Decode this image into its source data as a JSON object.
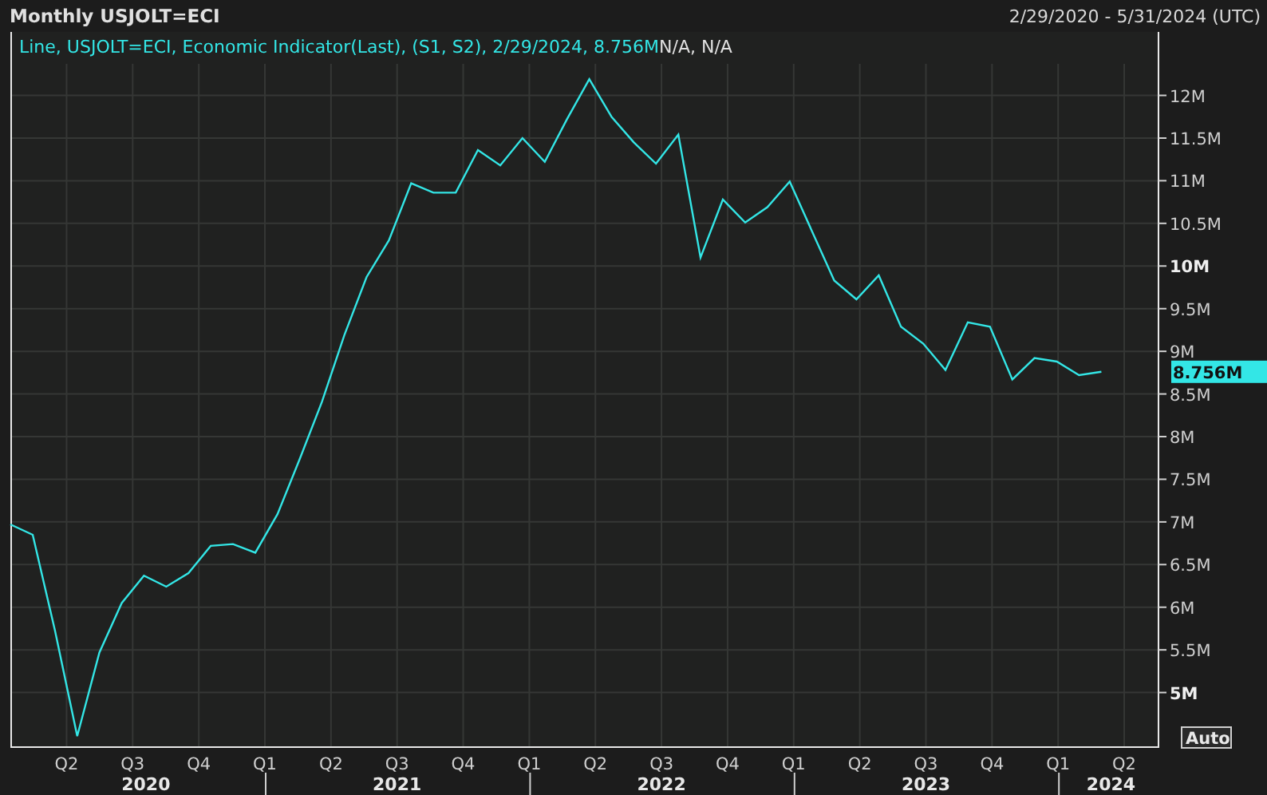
{
  "header": {
    "title": "Monthly USJOLT=ECI",
    "date_range": "2/29/2020 - 5/31/2024 (UTC)"
  },
  "chart": {
    "legend": {
      "series_text": "Line, USJOLT=ECI, Economic Indicator(Last), (S1, S2), 2/29/2024, 8.756M",
      "extra_text": "N/A, N/A"
    },
    "last_value": "8.756M",
    "auto_button": "Auto",
    "quarter_labels": [
      "Q2",
      "Q3",
      "Q4",
      "Q1",
      "Q2",
      "Q3",
      "Q4",
      "Q1",
      "Q2",
      "Q3",
      "Q4",
      "Q1",
      "Q2",
      "Q3",
      "Q4",
      "Q1",
      "Q2"
    ],
    "year_labels": [
      "2020",
      "2021",
      "2022",
      "2023",
      "2024"
    ],
    "chart_data": {
      "type": "line",
      "grid": true,
      "categories": [
        null,
        null,
        null,
        null,
        null,
        null,
        null,
        null,
        null,
        null,
        null,
        null,
        null,
        null,
        null,
        null,
        null,
        null,
        null,
        null,
        null,
        null,
        null,
        null,
        null,
        null,
        null,
        null,
        null,
        null,
        null,
        null,
        null,
        null,
        null,
        null,
        null,
        null,
        null,
        null,
        null,
        null,
        null,
        null,
        null,
        null,
        null,
        null,
        null,
        null
      ],
      "series": [
        {
          "color": "#33e6e6",
          "values": [
            6.97,
            6.85,
            5.73,
            4.49,
            5.47,
            6.05,
            6.37,
            6.24,
            6.4,
            6.72,
            6.74,
            6.64,
            7.09,
            7.74,
            8.41,
            9.19,
            9.87,
            10.3,
            10.97,
            10.86,
            10.86,
            11.36,
            11.18,
            11.5,
            11.22,
            11.72,
            12.19,
            11.75,
            11.45,
            11.2,
            11.54,
            10.1,
            10.78,
            10.51,
            10.69,
            10.99,
            10.41,
            9.83,
            9.61,
            9.89,
            9.29,
            9.09,
            8.78,
            9.34,
            9.29,
            8.67,
            8.92,
            8.88,
            8.72,
            8.76
          ]
        }
      ],
      "ylim": [
        4.36,
        12.37
      ],
      "yticks": [
        {
          "value": 12,
          "label": "12M"
        },
        {
          "value": 11.5,
          "label": "11.5M"
        },
        {
          "value": 11,
          "label": "11M"
        },
        {
          "value": 10.5,
          "label": "10.5M"
        },
        {
          "value": 10,
          "label": "10M"
        },
        {
          "value": 9.5,
          "label": "9.5M"
        },
        {
          "value": 9,
          "label": "9M"
        },
        {
          "value": 8.5,
          "label": "8.5M"
        },
        {
          "value": 8,
          "label": "8M"
        },
        {
          "value": 7.5,
          "label": "7.5M"
        },
        {
          "value": 7,
          "label": "7M"
        },
        {
          "value": 6.5,
          "label": "6.5M"
        },
        {
          "value": 6,
          "label": "6M"
        },
        {
          "value": 5.5,
          "label": "5.5M"
        },
        {
          "value": 5,
          "label": "5M"
        }
      ]
    }
  }
}
